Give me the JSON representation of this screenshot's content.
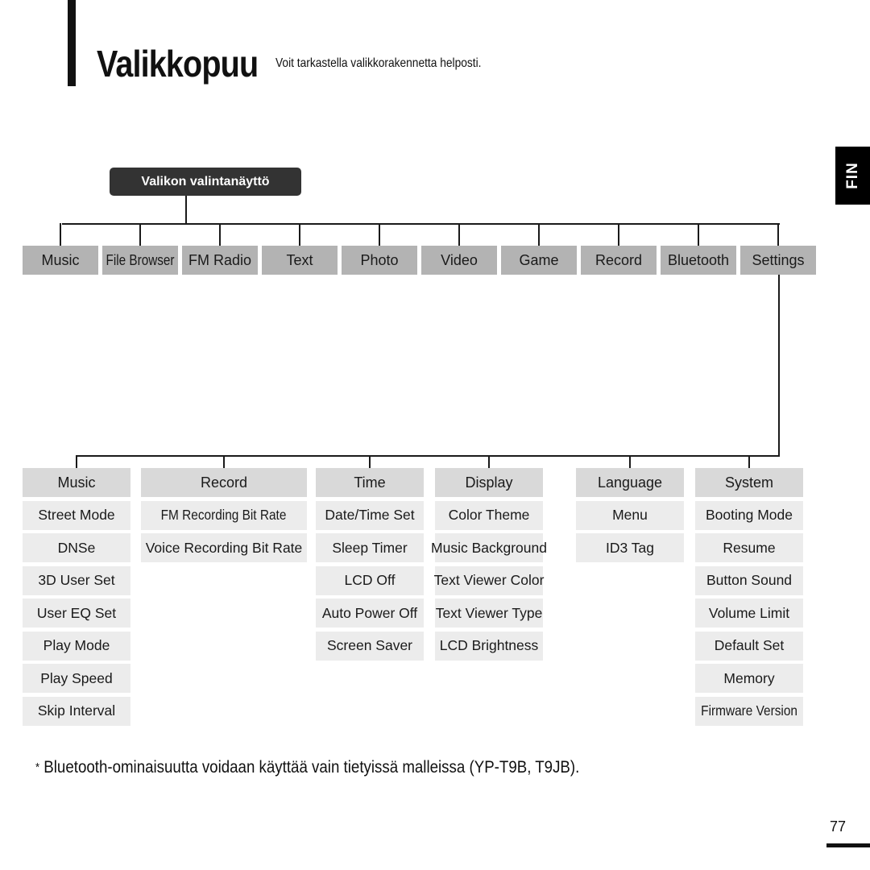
{
  "page": {
    "title": "Valikkopuu",
    "subtitle": "Voit tarkastella valikkorakennetta helposti.",
    "language_tab": "FIN",
    "page_number": "77"
  },
  "tree": {
    "root": "Valikon valintanäyttö",
    "top_level": [
      {
        "label": "Music"
      },
      {
        "label": "File Browser"
      },
      {
        "label": "FM Radio"
      },
      {
        "label": "Text"
      },
      {
        "label": "Photo"
      },
      {
        "label": "Video"
      },
      {
        "label": "Game"
      },
      {
        "label": "Record"
      },
      {
        "label": "Bluetooth"
      },
      {
        "label": "Settings"
      }
    ],
    "expanded_parent": "Settings",
    "settings_groups": [
      {
        "label": "Music",
        "items": [
          "Street Mode",
          "DNSe",
          "3D User Set",
          "User EQ Set",
          "Play Mode",
          "Play Speed",
          "Skip Interval"
        ]
      },
      {
        "label": "Record",
        "items": [
          "FM Recording Bit Rate",
          "Voice Recording Bit Rate"
        ]
      },
      {
        "label": "Time",
        "items": [
          "Date/Time Set",
          "Sleep Timer",
          "LCD Off",
          "Auto Power Off",
          "Screen Saver"
        ]
      },
      {
        "label": "Display",
        "items": [
          "Color Theme",
          "Music Background",
          "Text Viewer Color",
          "Text Viewer Type",
          "LCD Brightness"
        ]
      },
      {
        "label": "Language",
        "items": [
          "Menu",
          "ID3 Tag"
        ]
      },
      {
        "label": "System",
        "items": [
          "Booting Mode",
          "Resume",
          "Button Sound",
          "Volume Limit",
          "Default Set",
          "Memory",
          "Firmware Version"
        ]
      }
    ]
  },
  "footnote": {
    "marker": "*",
    "text": "Bluetooth-ominaisuutta voidaan käyttää vain tietyissä malleissa (YP-T9B, T9JB)."
  },
  "colors": {
    "root_box": "#333333",
    "top_item": "#b3b3b3",
    "group_header": "#d9d9d9",
    "group_item": "#ececec",
    "lines": "#1a1a1a"
  }
}
